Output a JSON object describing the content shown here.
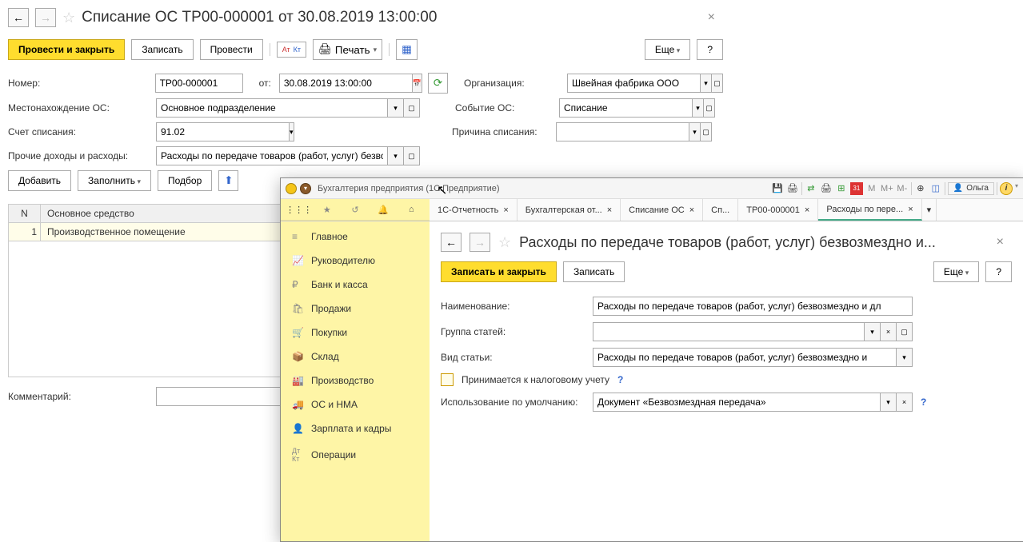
{
  "back": {
    "title": "Списание ОС ТР00-000001 от 30.08.2019 13:00:00",
    "buttons": {
      "conduct_close": "Провести и закрыть",
      "write": "Записать",
      "conduct": "Провести",
      "print": "Печать",
      "more": "Еще",
      "add": "Добавить",
      "fill": "Заполнить",
      "select": "Подбор"
    },
    "labels": {
      "number": "Номер:",
      "from": "от:",
      "org": "Организация:",
      "location": "Местонахождение ОС:",
      "event": "Событие ОС:",
      "account": "Счет списания:",
      "reason": "Причина списания:",
      "other": "Прочие доходы и расходы:",
      "comment": "Комментарий:"
    },
    "values": {
      "number": "ТР00-000001",
      "date": "30.08.2019 13:00:00",
      "org": "Швейная фабрика ООО",
      "location": "Основное подразделение",
      "event": "Списание",
      "account": "91.02",
      "reason": "",
      "other": "Расходы по передаче товаров (работ, услуг) безво",
      "comment": ""
    },
    "table": {
      "col_n": "N",
      "col_main": "Основное средство",
      "row1_n": "1",
      "row1_main": "Производственное помещение"
    }
  },
  "front": {
    "app_title": "Бухгалтерия предприятия     (1С:Предприятие)",
    "user": "Ольга",
    "tabs": {
      "t1": "1С-Отчетность",
      "t2": "Бухгалтерская от...",
      "t3": "Списание ОС",
      "t4": "Сп...",
      "t5": "ТР00-000001",
      "t6": "Расходы по пере..."
    },
    "menu": {
      "m1": "Главное",
      "m2": "Руководителю",
      "m3": "Банк и касса",
      "m4": "Продажи",
      "m5": "Покупки",
      "m6": "Склад",
      "m7": "Производство",
      "m8": "ОС и НМА",
      "m9": "Зарплата и кадры",
      "m10": "Операции"
    },
    "page": {
      "title": "Расходы по передаче товаров (работ, услуг) безвозмездно и...",
      "write_close": "Записать и закрыть",
      "write": "Записать",
      "more": "Еще",
      "labels": {
        "name": "Наименование:",
        "group": "Группа статей:",
        "type": "Вид статьи:",
        "tax": "Принимается к налоговому учету",
        "default": "Использование по умолчанию:"
      },
      "values": {
        "name": "Расходы по передаче товаров (работ, услуг) безвозмездно и дл",
        "group": "",
        "type": "Расходы по передаче товаров (работ, услуг) безвозмездно и",
        "default": "Документ «Безвозмездная передача»"
      }
    }
  }
}
